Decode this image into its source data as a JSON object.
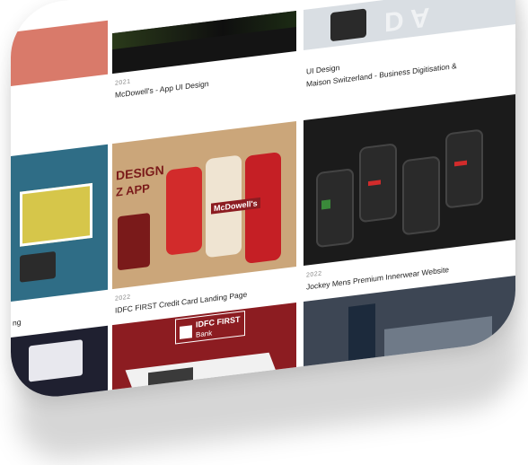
{
  "projects": [
    {
      "title": "McDowell's - App UI Design",
      "year": "2021"
    },
    {
      "title": "Maison Switzerland - Business Digitisation & UI Design",
      "title_line1": "Maison Switzerland - Business Digitisation &",
      "title_line2": "UI Design",
      "year": ""
    },
    {
      "title": "IDFC FIRST Credit Card Landing Page",
      "year": "2022"
    },
    {
      "title": "Jockey Mens Premium Innerwear Website",
      "year": "2022"
    },
    {
      "title_partial": "ng",
      "year": ""
    }
  ],
  "tile_text": {
    "design_word": "DESIGN",
    "app_word": "Z APP",
    "brand_word": "McDowell's",
    "bank_logo": "IDFC FIRST",
    "bank_sub": "Bank"
  },
  "colors": {
    "coral": "#d97a6a",
    "dark": "#141414",
    "tan": "#cba67a",
    "crimson": "#8c1c21",
    "teal": "#2f6d86",
    "red_accent": "#d22b2b"
  }
}
